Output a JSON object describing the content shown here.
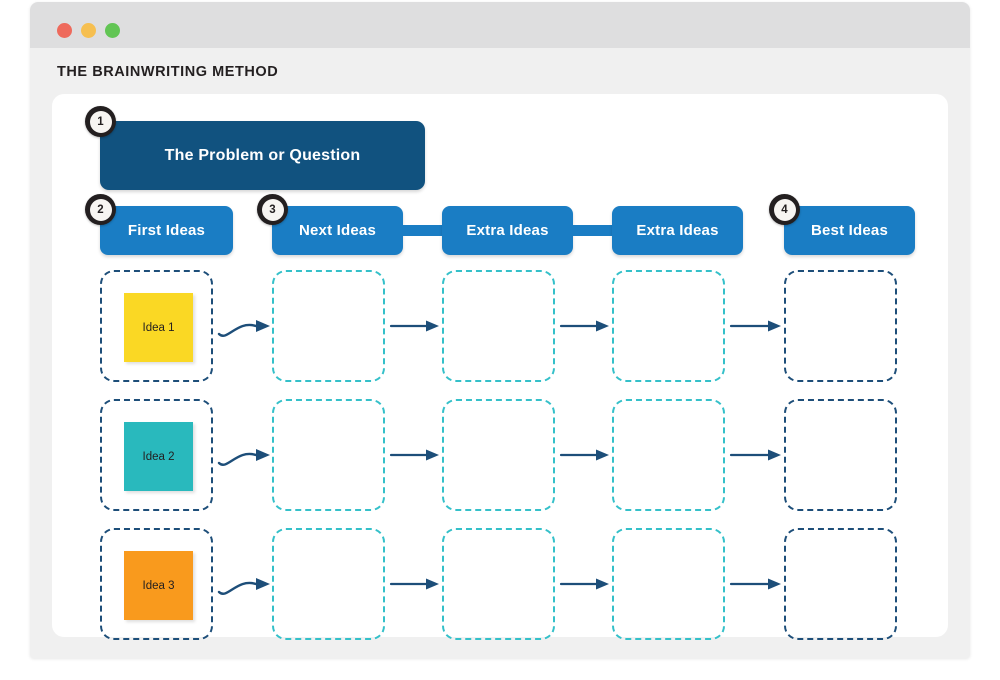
{
  "window": {
    "traffic_lights": [
      {
        "name": "close",
        "color": "#ee6a5c"
      },
      {
        "name": "minimize",
        "color": "#f6bf50"
      },
      {
        "name": "maximize",
        "color": "#62c554"
      }
    ]
  },
  "page": {
    "title": "THE BRAINWRITING METHOD"
  },
  "colors": {
    "dark_blue": "#11527f",
    "blue": "#1a7dc4",
    "navy_dash": "#1d4e79",
    "teal_dash": "#34c0c9",
    "arrow": "#1d4e79",
    "badge_ring": "#231f20",
    "badge_face": "#f7f5f2"
  },
  "problem": {
    "label": "The Problem or Question",
    "badge": "1"
  },
  "columns": [
    {
      "id": "first-ideas",
      "label": "First Ideas",
      "badge": "2",
      "dash": "navy",
      "connector_after": false
    },
    {
      "id": "next-ideas",
      "label": "Next Ideas",
      "badge": "3",
      "dash": "teal",
      "connector_after": true
    },
    {
      "id": "extra-ideas-1",
      "label": "Extra Ideas",
      "badge": "",
      "dash": "teal",
      "connector_after": true
    },
    {
      "id": "extra-ideas-2",
      "label": "Extra Ideas",
      "badge": "",
      "dash": "teal",
      "connector_after": false
    },
    {
      "id": "best-ideas",
      "label": "Best Ideas",
      "badge": "4",
      "dash": "navy",
      "connector_after": false
    }
  ],
  "rows": [
    {
      "id": "row-1",
      "card_label": "Idea 1",
      "card_color": "#fad824"
    },
    {
      "id": "row-2",
      "card_label": "Idea 2",
      "card_color": "#29b9bd"
    },
    {
      "id": "row-3",
      "card_label": "Idea 3",
      "card_color": "#f99a1d"
    }
  ]
}
